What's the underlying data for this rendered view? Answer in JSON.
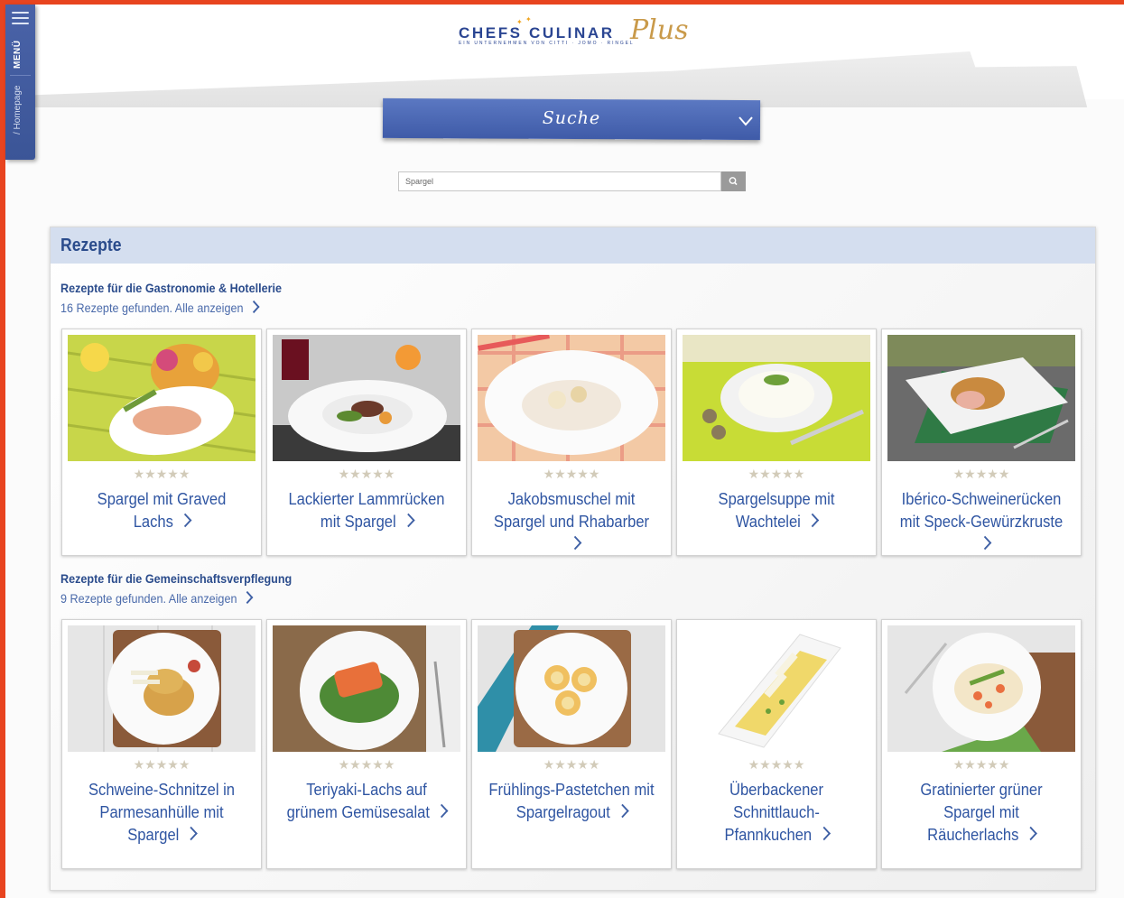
{
  "side_menu": {
    "menu_label": "MENÜ",
    "homepage_label": "/ Homepage"
  },
  "logo": {
    "main": "CHEFS CULINAR",
    "sub": "EIN UNTERNEHMEN VON CITTI · JOMO · RINGEL",
    "plus": "Plus"
  },
  "search_banner": {
    "title": "Suche"
  },
  "search": {
    "value": "Spargel"
  },
  "panel": {
    "title": "Rezepte",
    "sections": [
      {
        "title": "Rezepte für die Gastronomie & Hotellerie",
        "count": "16 Rezepte gefunden. Alle anzeigen",
        "cards": [
          {
            "title": "Spargel mit Graved Lachs",
            "stars": "★★★★★",
            "rating": 0
          },
          {
            "title": "Lackierter Lammrücken mit Spargel",
            "stars": "★★★★★",
            "rating": 0
          },
          {
            "title": "Jakobsmuschel mit Spargel und Rhabarber",
            "stars": "★★★★★",
            "rating": 0
          },
          {
            "title": "Spargelsuppe mit Wachtelei",
            "stars": "★★★★★",
            "rating": 0
          },
          {
            "title": "Ibérico-Schweinerücken mit Speck-Gewürzkruste",
            "stars": "★★★★★",
            "rating": 0
          }
        ]
      },
      {
        "title": "Rezepte für die Gemeinschaftsverpflegung",
        "count": "9 Rezepte gefunden. Alle anzeigen",
        "cards": [
          {
            "title": "Schweine-Schnitzel in Parmesanhülle mit Spargel",
            "stars": "★★★★★",
            "rating": 0
          },
          {
            "title": "Teriyaki-Lachs auf grünem Gemüsesalat",
            "stars": "★★★★★",
            "rating": 0
          },
          {
            "title": "Frühlings-Pastetchen mit Spargelragout",
            "stars": "★★★★★",
            "rating": 0
          },
          {
            "title": "Überbackener Schnittlauch-Pfannkuchen",
            "stars": "★★★★★",
            "rating": 0
          },
          {
            "title": "Gratinierter grüner Spargel mit Räucherlachs",
            "stars": "★★★★★",
            "rating": 0
          }
        ]
      }
    ]
  },
  "colors": {
    "frame": "#e8441f",
    "brand_blue": "#3f5ba8",
    "panel_header": "#d4deef",
    "star_empty": "#d2cbb9"
  }
}
